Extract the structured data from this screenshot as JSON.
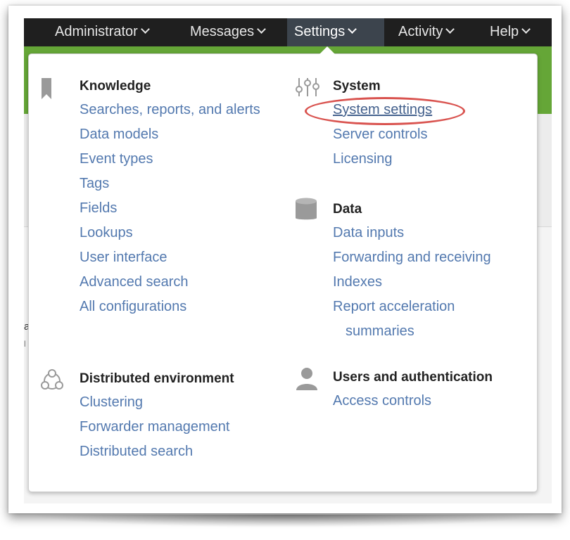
{
  "nav": {
    "items": [
      {
        "label": "Administrator"
      },
      {
        "label": "Messages"
      },
      {
        "label": "Settings"
      },
      {
        "label": "Activity"
      },
      {
        "label": "Help"
      }
    ],
    "active": "Settings"
  },
  "background": {
    "partial_text_1": "a",
    "partial_text_2": "l"
  },
  "menu": {
    "knowledge": {
      "heading": "Knowledge",
      "icon": "bookmark-icon",
      "links": [
        "Searches, reports, and alerts",
        "Data models",
        "Event types",
        "Tags",
        "Fields",
        "Lookups",
        "User interface",
        "Advanced search",
        "All configurations"
      ]
    },
    "distributed": {
      "heading": "Distributed environment",
      "icon": "distributed-network-icon",
      "links": [
        "Clustering",
        "Forwarder management",
        "Distributed search"
      ]
    },
    "system": {
      "heading": "System",
      "icon": "sliders-icon",
      "links": [
        "System settings",
        "Server controls",
        "Licensing"
      ]
    },
    "data": {
      "heading": "Data",
      "icon": "database-icon",
      "links": [
        "Data inputs",
        "Forwarding and receiving",
        "Indexes",
        "Report acceleration",
        "summaries"
      ]
    },
    "users": {
      "heading": "Users and authentication",
      "icon": "user-icon",
      "links": [
        "Access controls"
      ]
    }
  },
  "colors": {
    "topbar": "#1f1f1f",
    "active_tab": "#3c444d",
    "brand_green": "#65a637",
    "link": "#5379af",
    "highlight_ring": "#d9534f"
  }
}
